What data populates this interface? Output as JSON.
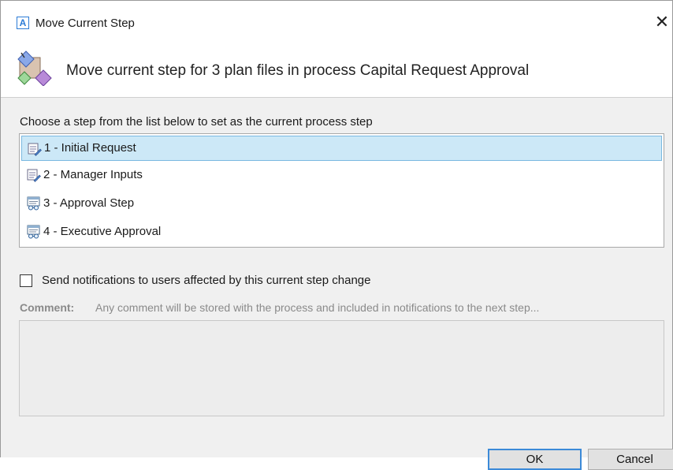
{
  "window": {
    "app_icon_letter": "A",
    "title": "Move Current Step",
    "close_glyph": "✕"
  },
  "header": {
    "icon": "process-diamond-icon",
    "text": "Move current step for 3 plan files in process Capital Request Approval"
  },
  "instruction": "Choose a step from the list below to set as the current process step",
  "steps": [
    {
      "label": "1 - Initial Request",
      "icon": "form-edit-icon",
      "selected": true
    },
    {
      "label": "2 - Manager Inputs",
      "icon": "form-edit-icon",
      "selected": false
    },
    {
      "label": "3 - Approval Step",
      "icon": "approval-review-icon",
      "selected": false
    },
    {
      "label": "4 - Executive Approval",
      "icon": "approval-review-icon",
      "selected": false
    }
  ],
  "notify": {
    "label": "Send notifications to users affected by this current step change",
    "checked": false
  },
  "comment": {
    "label": "Comment:",
    "placeholder": "Any comment will be stored with the process and included in notifications to the next step...",
    "value": ""
  },
  "buttons": {
    "ok": "OK",
    "cancel": "Cancel"
  },
  "colors": {
    "accent": "#2b7bd6",
    "selection_bg": "#cce8f7",
    "selection_border": "#7ab8e0"
  }
}
